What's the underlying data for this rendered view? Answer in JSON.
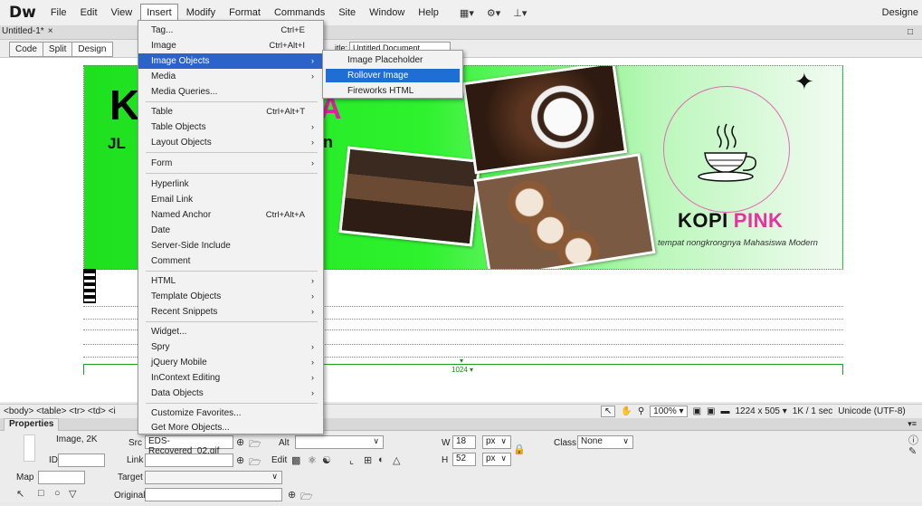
{
  "app": {
    "logo": "Dw",
    "menus": [
      "File",
      "Edit",
      "View",
      "Insert",
      "Modify",
      "Format",
      "Commands",
      "Site",
      "Window",
      "Help"
    ],
    "mode": "Designe"
  },
  "doc": {
    "tab": "Untitled-1*",
    "tab_close": "×",
    "view_buttons": [
      "Code",
      "Split",
      "Design"
    ],
    "title_label": "itle:",
    "title_value": "Untitled Document"
  },
  "banner": {
    "k_char": "K",
    "jl_text": "JL",
    "a_char": "A",
    "n_char": "n",
    "brand_kopi": "KOPI",
    "brand_pink": "PINK",
    "tagline": "tempat nongkrongnya Mahasiswa Modern",
    "brand_colors": {
      "green": "#2ef22e",
      "pink": "#ec2ea0"
    }
  },
  "design": {
    "table_width_label": "1024"
  },
  "insert_menu": {
    "items": [
      {
        "label": "Tag...",
        "shortcut": "Ctrl+E"
      },
      {
        "label": "Image",
        "shortcut": "Ctrl+Alt+I"
      },
      {
        "label": "Image Objects",
        "submenu": true
      },
      {
        "label": "Media",
        "submenu": true
      },
      {
        "label": "Media Queries..."
      },
      {
        "label": "Table",
        "shortcut": "Ctrl+Alt+T"
      },
      {
        "label": "Table Objects",
        "submenu": true
      },
      {
        "label": "Layout Objects",
        "submenu": true
      },
      {
        "label": "Form",
        "submenu": true
      },
      {
        "label": "Hyperlink"
      },
      {
        "label": "Email Link"
      },
      {
        "label": "Named Anchor",
        "shortcut": "Ctrl+Alt+A"
      },
      {
        "label": "Date"
      },
      {
        "label": "Server-Side Include"
      },
      {
        "label": "Comment"
      },
      {
        "label": "HTML",
        "submenu": true
      },
      {
        "label": "Template Objects",
        "submenu": true
      },
      {
        "label": "Recent Snippets",
        "submenu": true
      },
      {
        "label": "Widget..."
      },
      {
        "label": "Spry",
        "submenu": true
      },
      {
        "label": "jQuery Mobile",
        "submenu": true
      },
      {
        "label": "InContext Editing",
        "submenu": true
      },
      {
        "label": "Data Objects",
        "submenu": true
      },
      {
        "label": "Customize Favorites..."
      },
      {
        "label": "Get More Objects..."
      }
    ],
    "submenu_items": [
      "Image Placeholder",
      "Rollover Image",
      "Fireworks HTML"
    ]
  },
  "status": {
    "tag_selector": "<body> <table> <tr> <td> <i",
    "zoom": "100%",
    "dimensions": "1224 x 505",
    "download": "1K / 1 sec",
    "encoding": "Unicode (UTF-8)"
  },
  "properties": {
    "tab": "Properties",
    "type": "Image, 2K",
    "src_label": "Src",
    "src_value": "EDS-Recovered_02.gif",
    "alt_label": "Alt",
    "id_label": "ID",
    "link_label": "Link",
    "edit_label": "Edit",
    "w_label": "W",
    "w_value": "18",
    "w_unit": "px",
    "h_label": "H",
    "h_value": "52",
    "h_unit": "px",
    "class_label": "Class",
    "class_value": "None",
    "map_label": "Map",
    "target_label": "Target",
    "original_label": "Original"
  }
}
